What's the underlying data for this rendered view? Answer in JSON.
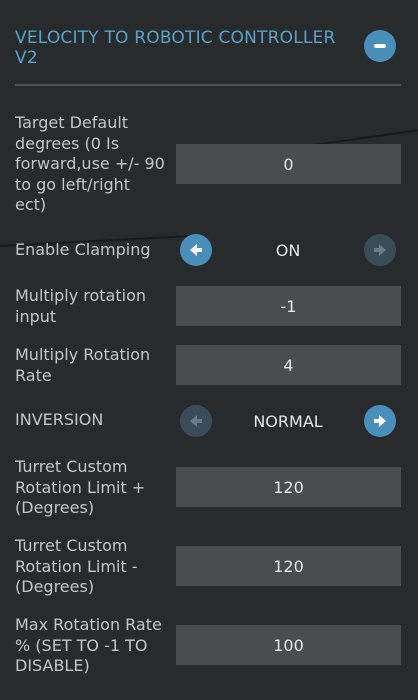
{
  "header": {
    "title": "VELOCITY TO ROBOTIC CONTROLLER V2",
    "collapse_icon": "minus-circle-icon"
  },
  "settings": {
    "target_default": {
      "label": "Target Default degrees (0 Is forward,use +/- 90 to go left/right ect)",
      "value": "0"
    },
    "clamping": {
      "label": "Enable Clamping",
      "value": "ON"
    },
    "multiply_input": {
      "label": "Multiply rotation input",
      "value": "-1"
    },
    "multiply_rate": {
      "label": "Multiply Rotation Rate",
      "value": "4"
    },
    "inversion": {
      "label": "INVERSION",
      "value": "NORMAL"
    },
    "limit_plus": {
      "label": "Turret Custom Rotation Limit + (Degrees)",
      "value": "120"
    },
    "limit_minus": {
      "label": "Turret Custom Rotation Limit - (Degrees)",
      "value": "120"
    },
    "max_rate": {
      "label": "Max Rotation Rate % (SET TO -1 TO DISABLE)",
      "value": "100"
    }
  },
  "colors": {
    "accent": "#4a8fba",
    "title": "#5aa3c5",
    "background": "#272b2d",
    "field": "#4a4d4f"
  }
}
